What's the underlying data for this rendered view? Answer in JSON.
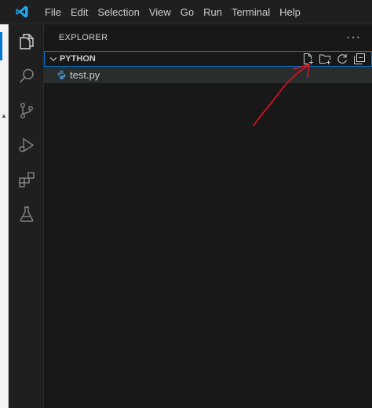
{
  "menu": {
    "items": [
      "File",
      "Edit",
      "Selection",
      "View",
      "Go",
      "Run",
      "Terminal",
      "Help"
    ]
  },
  "activity_bar": {
    "icons": [
      "explorer-icon",
      "search-icon",
      "source-control-icon",
      "run-debug-icon",
      "extensions-icon",
      "testing-icon"
    ],
    "active": "explorer-icon"
  },
  "explorer": {
    "title": "EXPLORER",
    "more": "···",
    "folder": {
      "name": "PYTHON",
      "actions": [
        "new-file-icon",
        "new-folder-icon",
        "refresh-icon",
        "collapse-all-icon"
      ]
    },
    "files": [
      {
        "name": "test.py",
        "icon": "python-file-icon"
      }
    ]
  },
  "colors": {
    "accent": "#0078d4",
    "annotation_arrow": "#e81123",
    "python_icon": "#3c78aa"
  }
}
